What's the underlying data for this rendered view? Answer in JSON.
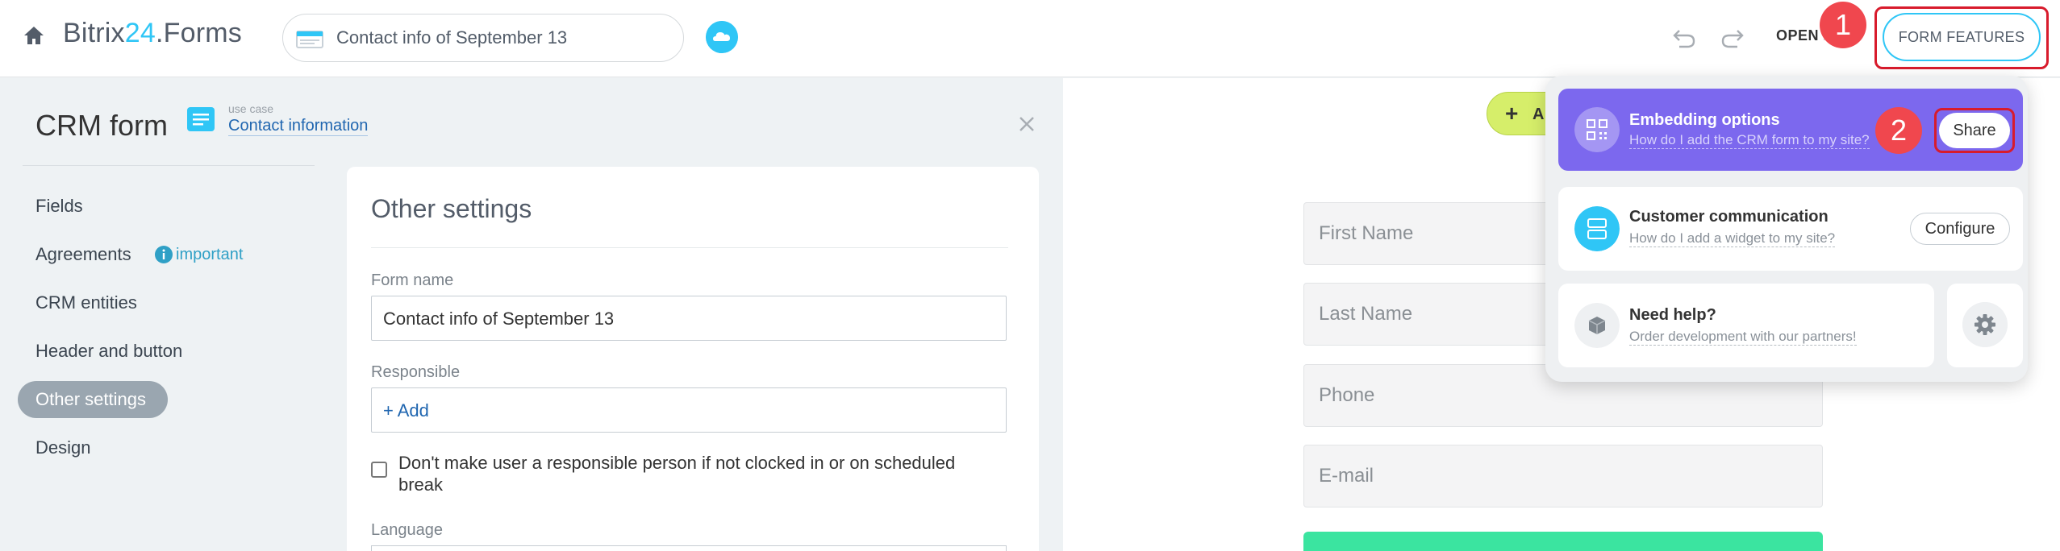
{
  "topbar": {
    "brand_prefix": "Bitrix",
    "brand_num": "24",
    "brand_suffix": ".Forms",
    "form_title": "Contact info of September 13",
    "open_label": "OPEN F",
    "form_features_label": "FORM FEATURES",
    "badge1": "1",
    "badge2": "2"
  },
  "sidebar": {
    "title": "CRM form",
    "usecase_caption": "use case",
    "usecase_link": "Contact information",
    "items": [
      {
        "label": "Fields"
      },
      {
        "label": "Agreements",
        "tag": "important"
      },
      {
        "label": "CRM entities"
      },
      {
        "label": "Header and button"
      },
      {
        "label": "Other settings"
      },
      {
        "label": "Design"
      }
    ]
  },
  "settings": {
    "title": "Other settings",
    "form_name_label": "Form name",
    "form_name_value": "Contact info of September 13",
    "responsible_label": "Responsible",
    "responsible_add": "+ Add",
    "checkbox_label": "Don't make user a responsible person if not clocked in or on scheduled break",
    "language_label": "Language"
  },
  "preview": {
    "add_button": "A",
    "fields": [
      "First Name",
      "Last Name",
      "Phone",
      "E-mail"
    ]
  },
  "features": {
    "embedding": {
      "title": "Embedding options",
      "subtitle": "How do I add the CRM form to my site?",
      "button": "Share"
    },
    "communication": {
      "title": "Customer communication",
      "subtitle": "How do I add a widget to my site?",
      "button": "Configure"
    },
    "help": {
      "title": "Need help?",
      "subtitle": "Order development with our partners!"
    }
  },
  "colors": {
    "accent_blue": "#2fc6f6",
    "embedding_purple": "#7c68ee",
    "highlight_red": "#d81b2c",
    "badge_red": "#f0474e",
    "add_green": "#d6ee6a",
    "submit_green": "#3be4a0"
  }
}
